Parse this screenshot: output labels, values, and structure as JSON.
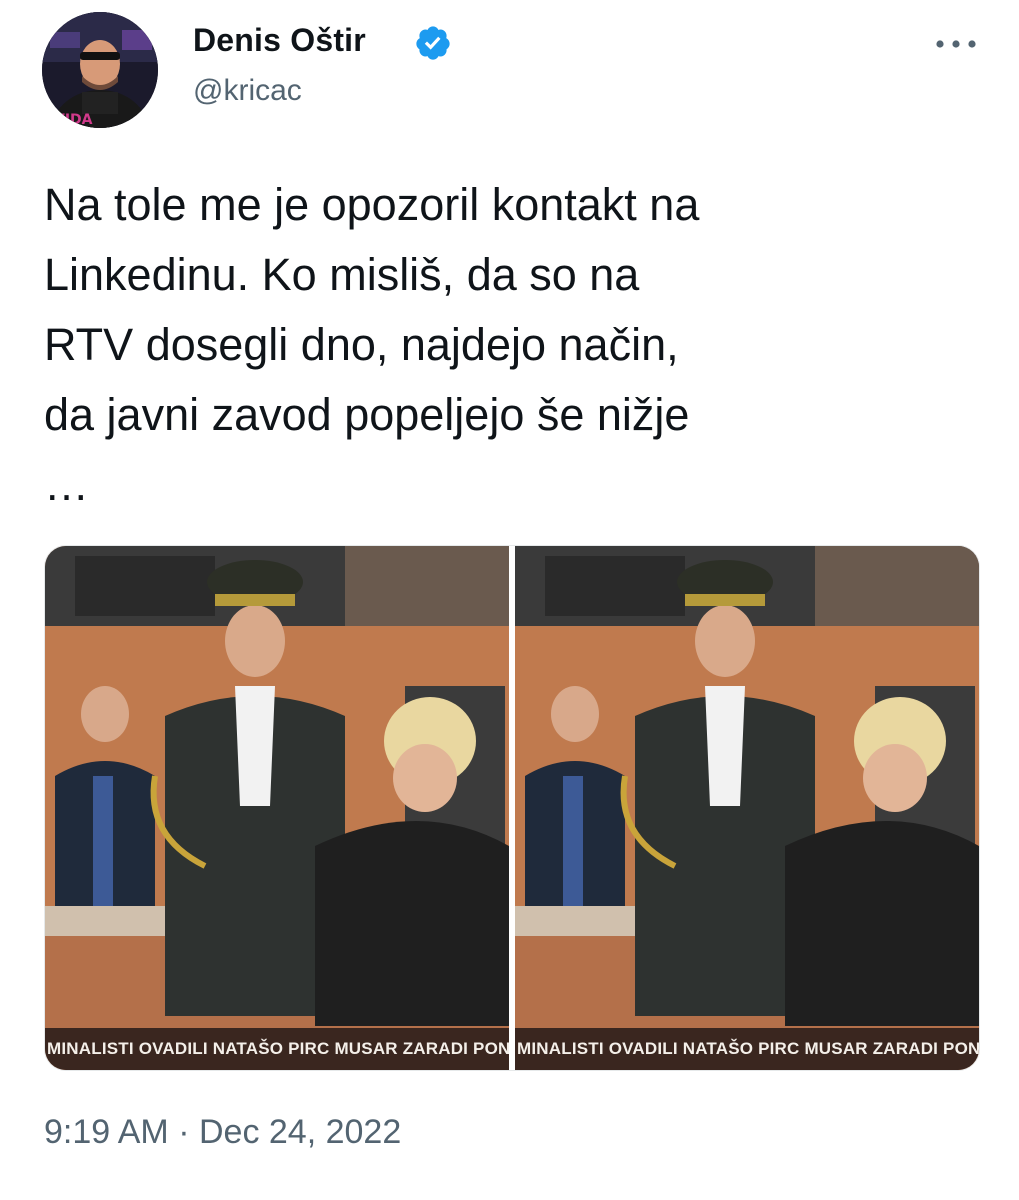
{
  "author": {
    "name": "Denis Oštir",
    "handle": "@kricac",
    "verified": true,
    "avatar_icon": "profile-photo"
  },
  "tweet": {
    "text": "Na tole me je opozoril kontakt na\nLinkedinu. Ko misliš, da so na\nRTV dosegli dno, najdejo način,\nda javni zavod popeljejo še nižje\n…",
    "time": "9:19 AM",
    "separator": "·",
    "date": "Dec 24, 2022"
  },
  "media": {
    "images": [
      {
        "ticker": "MINALISTI OVADILI NATAŠO PIRC MUSAR ZARADI PONA"
      },
      {
        "ticker": "MINALISTI OVADILI NATAŠO PIRC MUSAR ZARADI PONA"
      }
    ]
  },
  "icons": {
    "verified": "verified-badge-icon",
    "more": "more-options-icon"
  },
  "colors": {
    "text": "#0f1419",
    "secondary": "#536471",
    "verified": "#1d9bf0"
  }
}
